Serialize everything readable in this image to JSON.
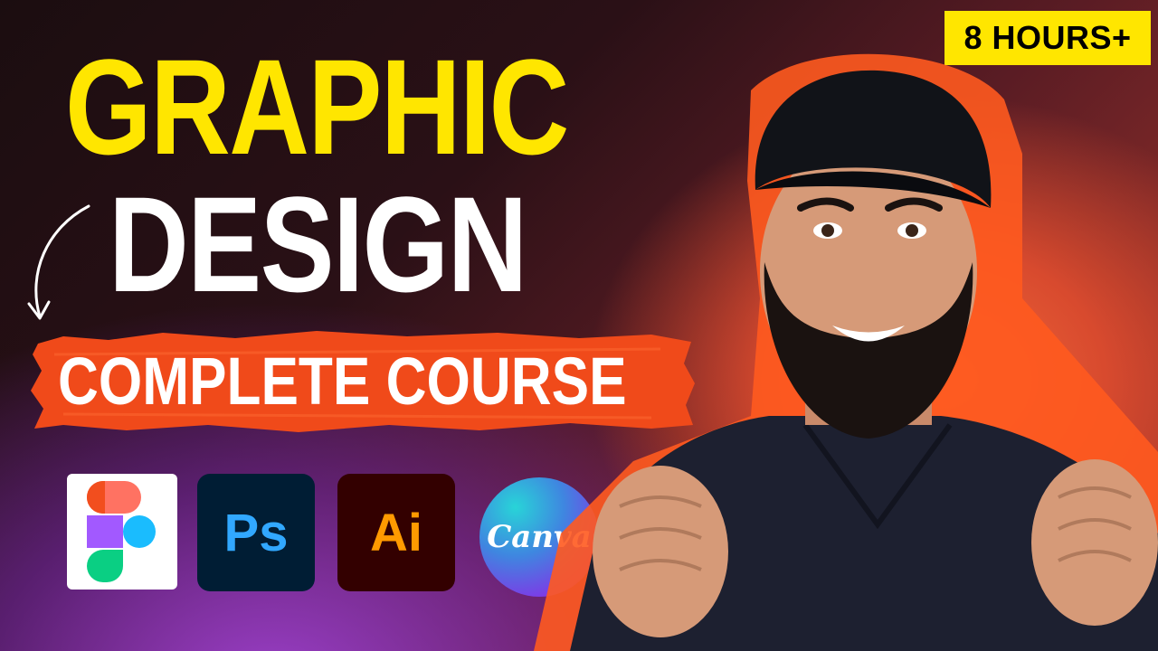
{
  "badge": {
    "text": "8 HOURS+"
  },
  "title": {
    "line1": "GRAPHIC",
    "line2": "DESIGN",
    "subtitle": "COMPLETE COURSE"
  },
  "apps": [
    {
      "name": "figma-icon",
      "label": ""
    },
    {
      "name": "photoshop-icon",
      "label": "Ps"
    },
    {
      "name": "illustrator-icon",
      "label": "Ai"
    },
    {
      "name": "canva-icon",
      "label": "Canva"
    }
  ],
  "colors": {
    "title_yellow": "#ffe600",
    "badge_yellow": "#ffe600",
    "brush_orange": "#f04a1a",
    "ps_blue": "#31a8ff",
    "ai_orange": "#ff9a00"
  }
}
